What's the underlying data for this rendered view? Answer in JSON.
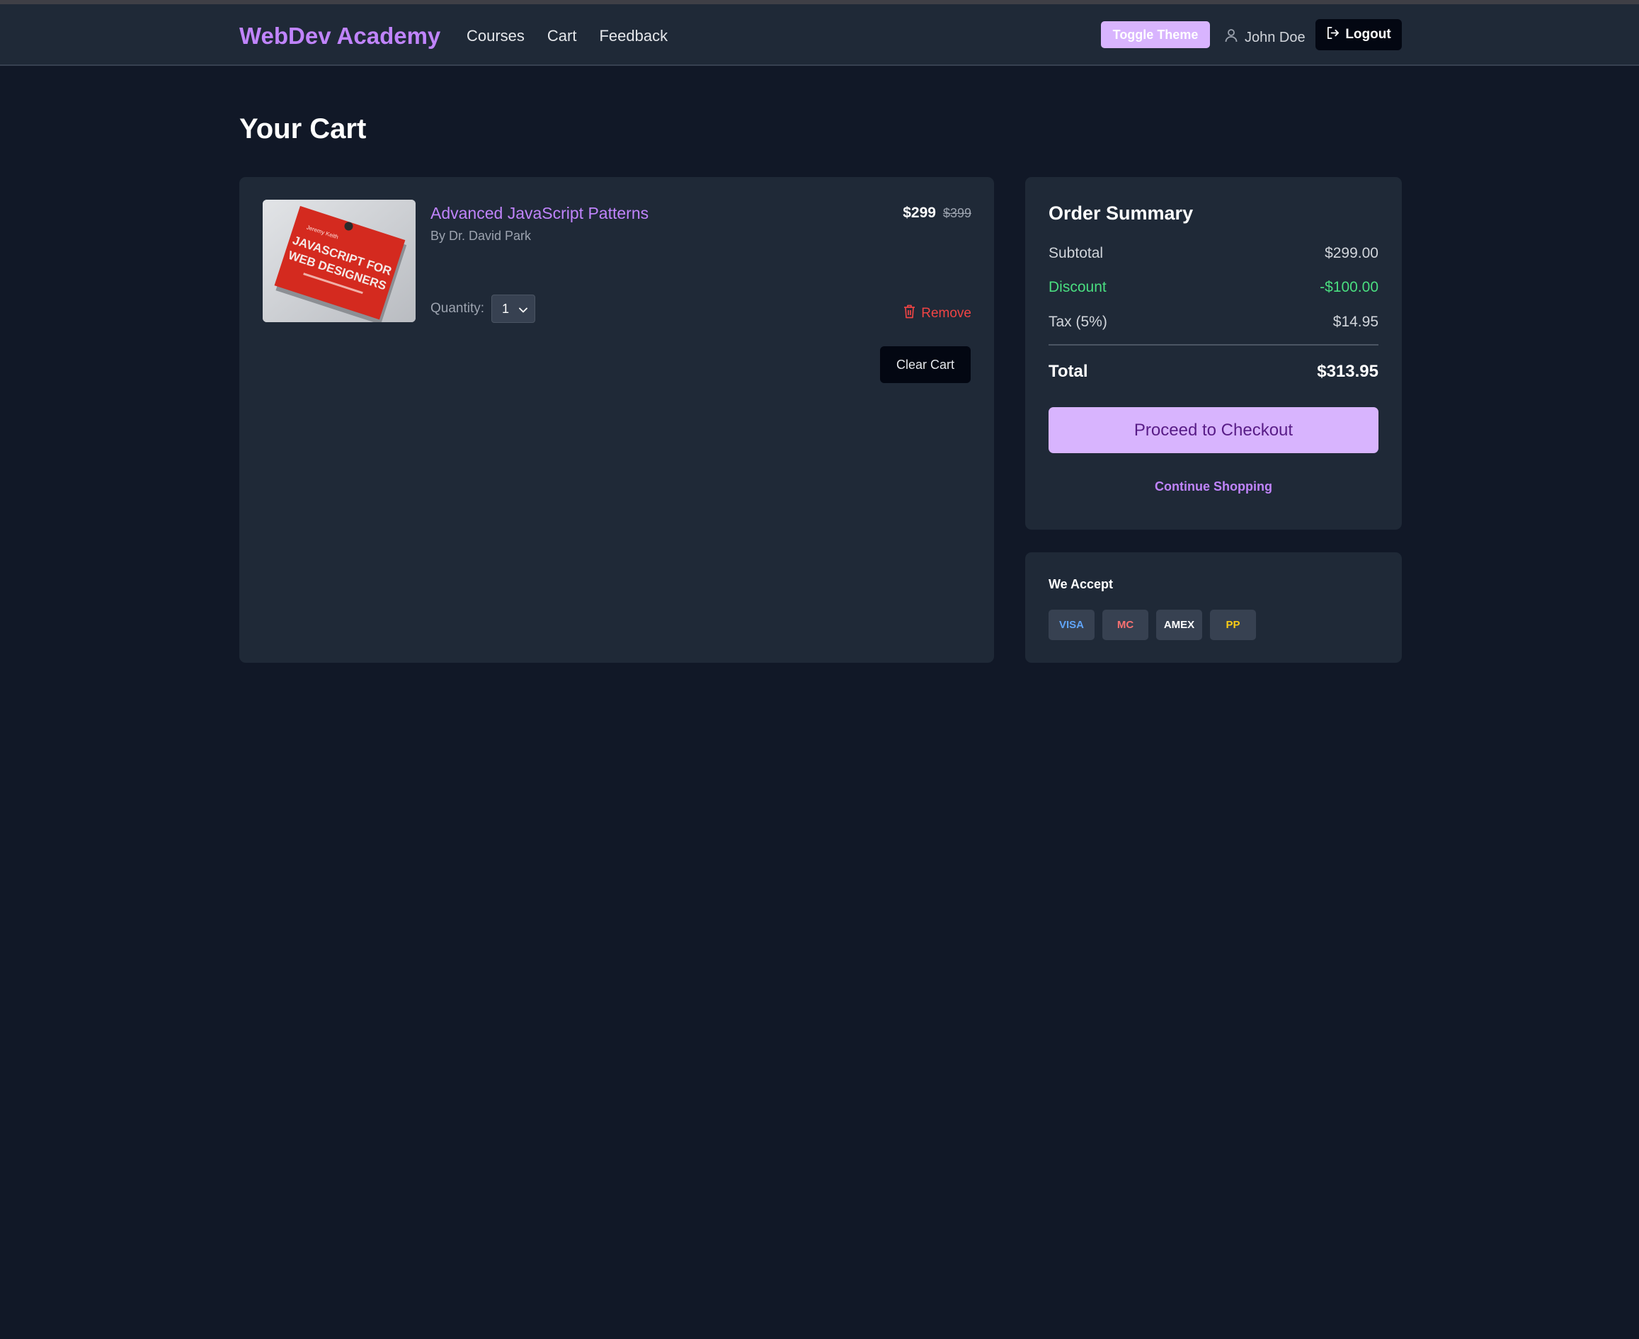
{
  "header": {
    "brand": "WebDev Academy",
    "nav": [
      "Courses",
      "Cart",
      "Feedback"
    ],
    "toggle_theme": "Toggle Theme",
    "user_name": "John Doe",
    "logout": "Logout"
  },
  "page": {
    "title": "Your Cart"
  },
  "cart": {
    "items": [
      {
        "title": "Advanced JavaScript Patterns",
        "author": "By Dr. David Park",
        "price": "$299",
        "original_price": "$399",
        "quantity_label": "Quantity:",
        "quantity": "1",
        "remove": "Remove",
        "book_cover_text": "JAVASCRIPT FOR WEB DESIGNERS"
      }
    ],
    "clear_cart": "Clear Cart"
  },
  "summary": {
    "title": "Order Summary",
    "subtotal_label": "Subtotal",
    "subtotal": "$299.00",
    "discount_label": "Discount",
    "discount": "-$100.00",
    "tax_label": "Tax (5%)",
    "tax": "$14.95",
    "total_label": "Total",
    "total": "$313.95",
    "checkout": "Proceed to Checkout",
    "continue": "Continue Shopping"
  },
  "payment": {
    "title": "We Accept",
    "cards": [
      {
        "label": "VISA",
        "color": "#60a5fa"
      },
      {
        "label": "MC",
        "color": "#f87171"
      },
      {
        "label": "AMEX",
        "color": "#ffffff"
      },
      {
        "label": "PP",
        "color": "#facc15"
      }
    ]
  },
  "colors": {
    "accent": "#c084fc",
    "accent_light": "#d8b4fe",
    "background": "#111827",
    "panel": "#1f2937",
    "danger": "#ef4444",
    "success": "#4ade80"
  }
}
